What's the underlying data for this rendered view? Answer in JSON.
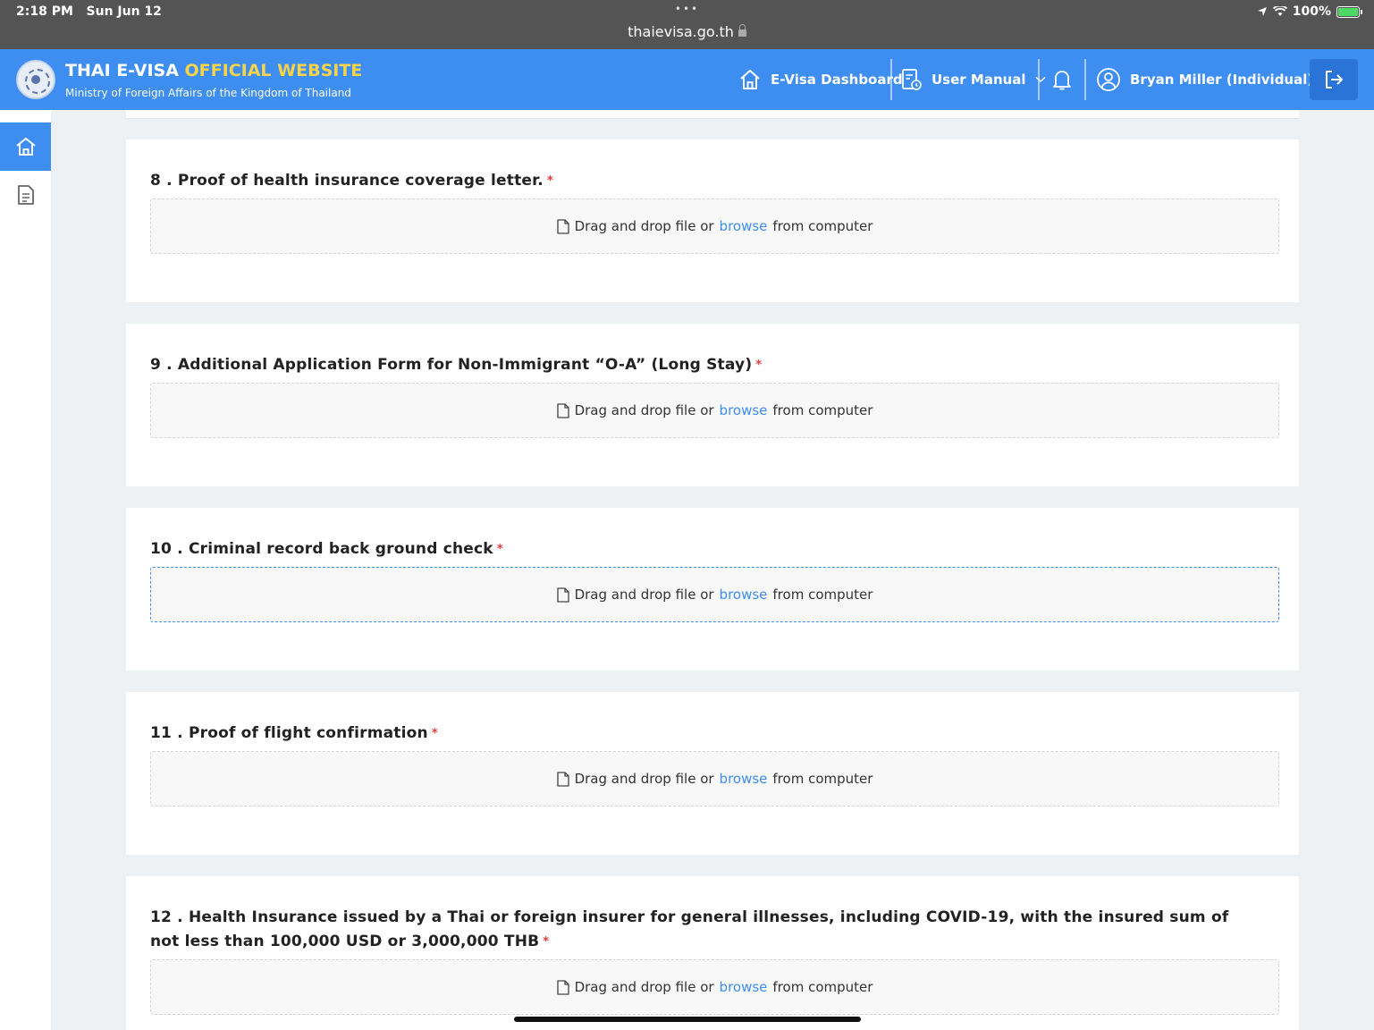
{
  "statusbar": {
    "time": "2:18 PM",
    "date": "Sun Jun 12",
    "url": "thaievisa.go.th",
    "battery": "100%"
  },
  "header": {
    "title_main": "THAI E-VISA",
    "title_highlight": "OFFICIAL WEBSITE",
    "subtitle": "Ministry of Foreign Affairs of the Kingdom of Thailand",
    "nav": {
      "dashboard_label": "E-Visa Dashboard",
      "manual_label": "User Manual",
      "user_label": "Bryan Miller (Individual)"
    }
  },
  "upload": {
    "text_before": "Drag and drop file or",
    "browse_label": "browse",
    "text_after": "from computer"
  },
  "documents": [
    {
      "title": "8 . Proof of health insurance coverage letter."
    },
    {
      "title": "9 . Additional Application Form for Non-Immigrant “O-A” (Long Stay)"
    },
    {
      "title": "10 . Criminal record back ground check"
    },
    {
      "title": "11 . Proof of flight confirmation"
    },
    {
      "title": "12 . Health Insurance issued by a Thai or foreign insurer for general illnesses, including COVID-19, with the insured sum of not less than 100,000 USD or 3,000,000 THB"
    }
  ],
  "required_mark": "*",
  "colors": {
    "primary": "#3d8ef0",
    "accent": "#f7d34a",
    "required": "#e03a3a"
  }
}
